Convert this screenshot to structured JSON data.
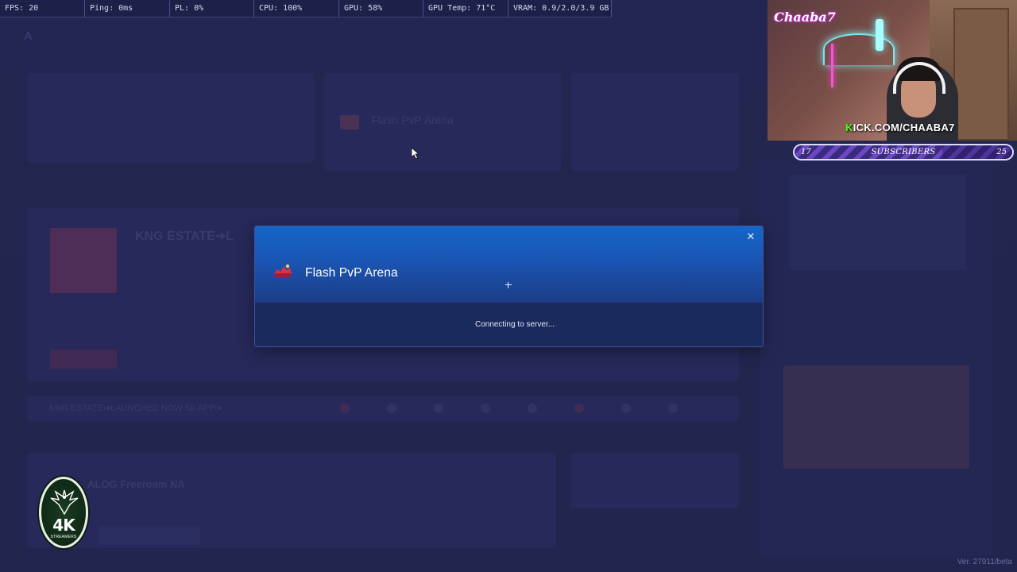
{
  "hud": {
    "fps": "FPS: 20",
    "ping": "Ping: 0ms",
    "pl": "PL: 0%",
    "cpu": "CPU: 100%",
    "gpu": "GPU: 58%",
    "gpu_temp": "GPU Temp: 71°C",
    "vram": "VRAM: 0.9/2.0/3.9 GB"
  },
  "background": {
    "nav": [
      "",
      "",
      "",
      ""
    ],
    "featured_server": "Flash PvP Arena",
    "big_card_title": "KNG ESTATE➔L",
    "strip_title": "KNG ESTATE➔LAUNCHED NOW 50-APP➔",
    "list_server": "ALOG Freeroam NA",
    "list_button": ""
  },
  "modal": {
    "server_name": "Flash PvP Arena",
    "status": "Connecting to server...",
    "close_icon": "close-icon",
    "server_icon": "flash-server-icon"
  },
  "webcam": {
    "channel_logo": "Chaaba7",
    "kick_url_k": "K",
    "kick_url_rest": "ICK.COM/CHAABA7"
  },
  "subscribers": {
    "current": "17",
    "label": "SUBSCRIBERS",
    "goal": "25",
    "progress": 0.68
  },
  "overlay_logo": {
    "text": "4K",
    "subtext": "STREAMERS"
  },
  "version": "Ver. 27911/beta",
  "colors": {
    "modal_header_top": "#1466c9",
    "modal_body": "#1b2a5c",
    "kick_green": "#53fc18",
    "background": "#2a2d5a"
  }
}
